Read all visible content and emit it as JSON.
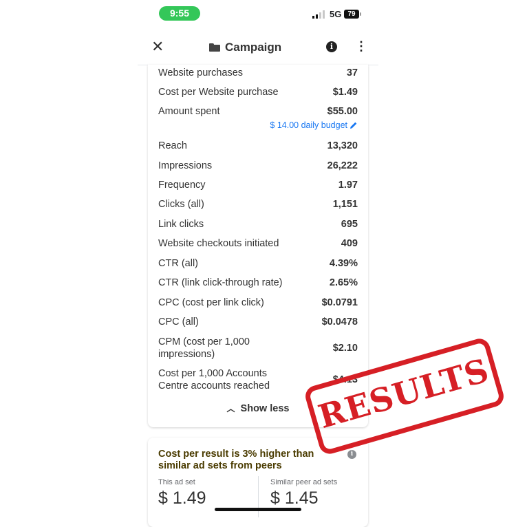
{
  "status_bar": {
    "time": "9:55",
    "network": "5G",
    "battery": "79",
    "time_pill_color": "#34c759"
  },
  "nav": {
    "title": "Campaign",
    "close_icon": "close-icon",
    "folder_icon": "folder-icon",
    "info_icon": "info-icon",
    "more_icon": "more-vertical-icon"
  },
  "metrics": [
    {
      "label": "Website purchases",
      "value": "37"
    },
    {
      "label": "Cost per Website purchase",
      "value": "$1.49"
    },
    {
      "label": "Amount spent",
      "value": "$55.00"
    },
    {
      "label": "Reach",
      "value": "13,320"
    },
    {
      "label": "Impressions",
      "value": "26,222"
    },
    {
      "label": "Frequency",
      "value": "1.97"
    },
    {
      "label": "Clicks (all)",
      "value": "1,151"
    },
    {
      "label": "Link clicks",
      "value": "695"
    },
    {
      "label": "Website checkouts initiated",
      "value": "409"
    },
    {
      "label": "CTR (all)",
      "value": "4.39%"
    },
    {
      "label": "CTR (link click-through rate)",
      "value": "2.65%"
    },
    {
      "label": "CPC (cost per link click)",
      "value": "$0.0791"
    },
    {
      "label": "CPC (all)",
      "value": "$0.0478"
    },
    {
      "label": "CPM (cost per 1,000 impressions)",
      "value": "$2.10"
    },
    {
      "label": "Cost per 1,000 Accounts Centre accounts reached",
      "value": "$4.13"
    }
  ],
  "budget_link": "$ 14.00 daily budget",
  "show_less_label": "Show less",
  "peer_card": {
    "title": "Cost per result is 3% higher than similar ad sets from peers",
    "this_label": "This ad set",
    "this_value": "$ 1.49",
    "peer_label": "Similar peer ad sets",
    "peer_value": "$ 1.45"
  },
  "stamp": {
    "text": "RESULTS",
    "color": "#d61f25"
  },
  "colors": {
    "link": "#1877f2",
    "peer_title": "#4a3b00"
  }
}
